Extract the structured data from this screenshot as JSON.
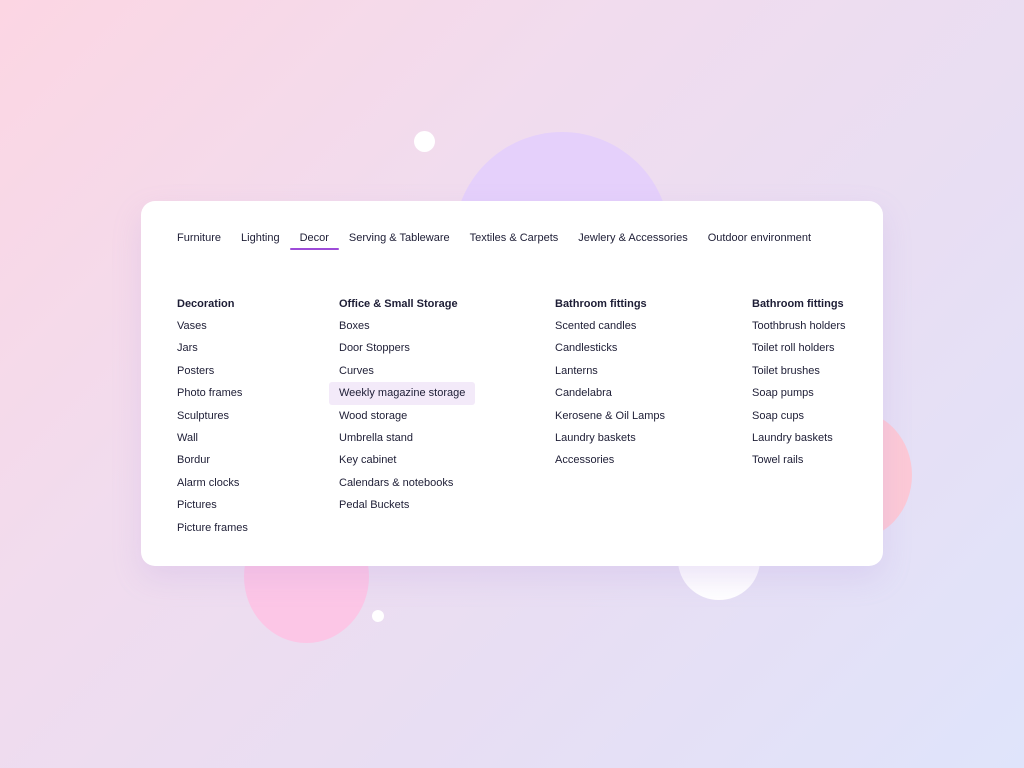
{
  "nav": {
    "tabs": [
      {
        "label": "Furniture"
      },
      {
        "label": "Lighting"
      },
      {
        "label": "Decor",
        "active": true
      },
      {
        "label": "Serving & Tableware"
      },
      {
        "label": "Textiles & Carpets"
      },
      {
        "label": "Jewlery & Accessories"
      },
      {
        "label": "Outdoor environment"
      }
    ]
  },
  "columns": [
    {
      "title": "Decoration",
      "items": [
        "Vases",
        "Jars",
        "Posters",
        "Photo frames",
        "Sculptures",
        "Wall",
        "Bordur",
        "Alarm clocks",
        "Pictures",
        "Picture frames"
      ]
    },
    {
      "title": "Office & Small Storage",
      "items": [
        "Boxes",
        "Door Stoppers",
        "Curves",
        "Weekly magazine storage",
        "Wood storage",
        "Umbrella stand",
        "Key cabinet",
        "Calendars & notebooks",
        "Pedal Buckets"
      ],
      "highlighted_item": "Weekly magazine storage"
    },
    {
      "title": "Bathroom fittings",
      "items": [
        "Scented candles",
        "Candlesticks",
        "Lanterns",
        "Candelabra",
        "Kerosene & Oil Lamps",
        "Laundry baskets",
        "Accessories"
      ]
    },
    {
      "title": "Bathroom fittings",
      "items": [
        "Toothbrush holders",
        "Toilet roll holders",
        "Toilet brushes",
        "Soap pumps",
        "Soap cups",
        "Laundry baskets",
        "Towel rails"
      ]
    }
  ],
  "colors": {
    "accent": "#9d4bd8",
    "text": "#1d1d35",
    "highlight_bg": "#f3eaf9"
  }
}
